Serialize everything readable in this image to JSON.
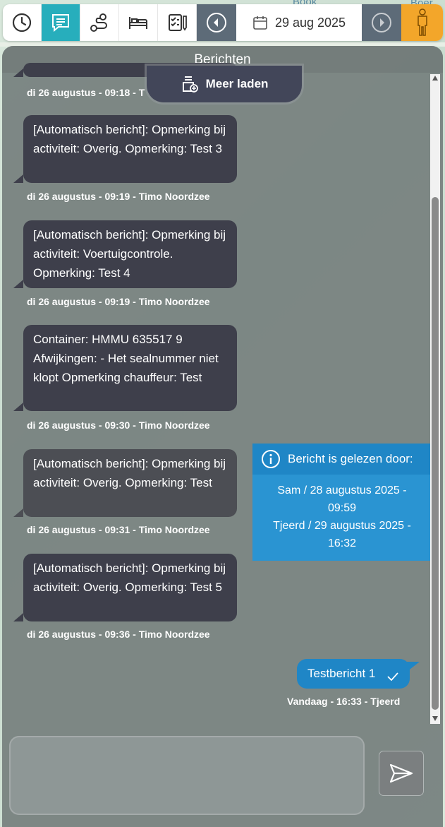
{
  "map": {
    "label_top": "Book",
    "label_right": "Boer"
  },
  "toolbar": {
    "buttons": [
      {
        "icon": "clock-icon"
      },
      {
        "icon": "messages-icon",
        "active": true
      },
      {
        "icon": "route-icon"
      },
      {
        "icon": "bed-icon"
      },
      {
        "icon": "checklist-icon"
      }
    ],
    "date": "29 aug 2025",
    "accent_active": "#27aebc",
    "accent_person": "#f3a62a"
  },
  "panel": {
    "title": "Berichten",
    "load_more_label": "Meer laden"
  },
  "messages": [
    {
      "text": "",
      "meta": "di 26 augustus - 09:18 - T"
    },
    {
      "text": "[Automatisch bericht]: Opmerking bij activiteit: Overig. Opmerking: Test 3",
      "meta": "di 26 augustus - 09:19 - Timo Noordzee"
    },
    {
      "text": "[Automatisch bericht]: Opmerking bij activiteit: Voertuigcontrole. Opmerking: Test 4",
      "meta": "di 26 augustus - 09:19 - Timo Noordzee"
    },
    {
      "text": "Container: HMMU 635517 9 Afwijkingen: - Het sealnummer niet klopt Opmerking chauffeur: Test",
      "meta": "di 26 augustus - 09:30 - Timo Noordzee"
    },
    {
      "text": "[Automatisch bericht]: Opmerking bij activiteit: Overig. Opmerking: Test",
      "meta": "di 26 augustus - 09:31 - Timo Noordzee"
    },
    {
      "text": "[Automatisch bericht]: Opmerking bij activiteit: Overig. Opmerking: Test 5",
      "meta": "di 26 augustus - 09:36 - Timo Noordzee"
    }
  ],
  "read_receipt": {
    "title": "Bericht is gelezen door:",
    "lines": [
      "Sam / 28 augustus 2025 -",
      "09:59",
      "Tjeerd / 29 augustus 2025 -",
      "16:32"
    ]
  },
  "own_message": {
    "text": "Testbericht 1",
    "meta": "Vandaag - 16:33 - Tjeerd"
  },
  "composer": {
    "value": "",
    "placeholder": ""
  }
}
